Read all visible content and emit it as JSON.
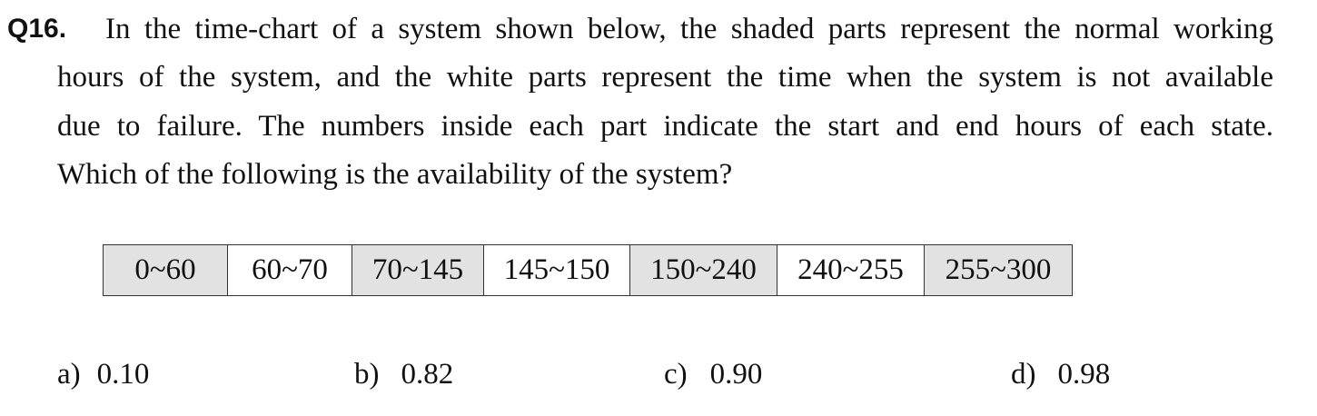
{
  "question": {
    "number": "Q16.",
    "lines": [
      "In the time-chart of a system shown below, the shaded parts represent the normal working",
      "hours of the system, and the white parts represent the time when the system is not available",
      "due to failure. The numbers inside each part indicate the start and end hours of each state.",
      "Which of the following is the availability of the system?"
    ]
  },
  "timechart": {
    "segments": [
      {
        "label": "0~60",
        "state": "working"
      },
      {
        "label": "60~70",
        "state": "failure"
      },
      {
        "label": "70~145",
        "state": "working"
      },
      {
        "label": "145~150",
        "state": "failure"
      },
      {
        "label": "150~240",
        "state": "working"
      },
      {
        "label": "240~255",
        "state": "failure"
      },
      {
        "label": "255~300",
        "state": "working"
      }
    ],
    "colors": {
      "working": "#e2e2e2",
      "failure": "#ffffff",
      "border": "#333333"
    }
  },
  "options": [
    {
      "label": "a)",
      "value": "0.10"
    },
    {
      "label": "b)",
      "value": "0.82"
    },
    {
      "label": "c)",
      "value": "0.90"
    },
    {
      "label": "d)",
      "value": "0.98"
    }
  ]
}
